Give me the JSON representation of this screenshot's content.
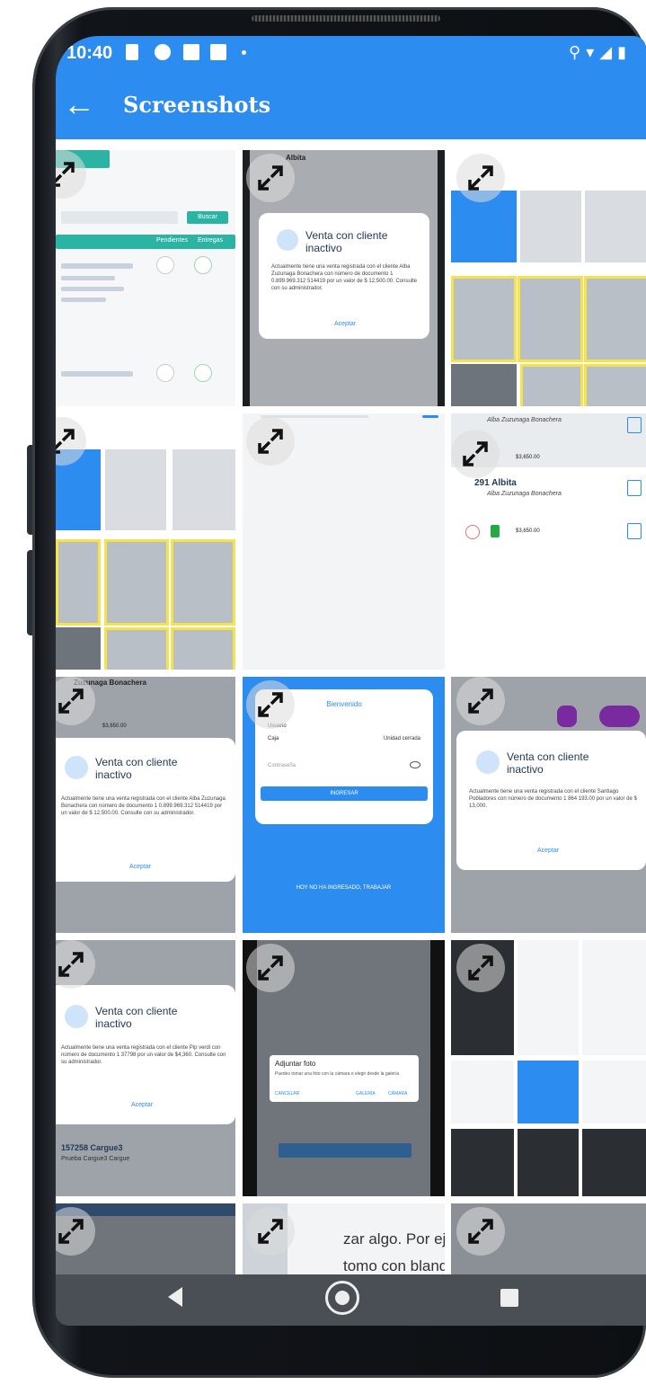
{
  "status_bar": {
    "time": "10:40"
  },
  "app_bar": {
    "title": "Screenshots",
    "back_icon": "arrow-left-icon"
  },
  "colors": {
    "accent": "#2d8cf0",
    "highlight": "#f4e34a",
    "overflow_dots": "#7a2a9f"
  },
  "tiles": {
    "t1": {
      "search_button": "Buscar",
      "tab_a": "Pendientes",
      "tab_b": "Entregas"
    },
    "t2": {
      "header": "Albita",
      "card_title": "Venta con cliente inactivo",
      "card_body": "Actualmente tiene una venta registrada con el cliente Alba Zuzunaga Bonachera con número de documento 1 0.899.969.312 514419 por un valor de $ 12,500.00. Consulte con su administrador.",
      "card_link": "Aceptar"
    },
    "t6": {
      "line1": "Alba Zuzunaga Bonachera",
      "name2": "291 Albita",
      "line2": "Alba Zuzunaga Bonachera",
      "amount1": "$3,650.00",
      "amount2": "$3,650.00"
    },
    "t7": {
      "header": "Zuzunaga Bonachera",
      "card_title": "Venta con cliente inactivo",
      "card_body": "Actualmente tiene una venta registrada con el cliente Alba Zuzunaga Bonachera con número de documento 1 0.899.969.312 514419 por un valor de $ 12,500.00. Consulte con su administrador.",
      "card_link": "Aceptar",
      "amount": "$3,650.00"
    },
    "t8": {
      "card_title": "Bienvenido",
      "field1": "Usuario",
      "field2": "Caja",
      "value2": "Unidad cerrada",
      "password_placeholder": "Contraseña",
      "button": "INGRESAR",
      "footer": "HOY NO HA INGRESADO, TRABAJAR"
    },
    "t9": {
      "card_title": "Venta con cliente inactivo",
      "card_body": "Actualmente tiene una venta registrada con el cliente Santiago Pobladores con número de documento 1 864 193.00 por un valor de $ 13,000.",
      "card_link": "Aceptar"
    },
    "t10": {
      "card_title": "Venta con cliente inactivo",
      "card_body": "Actualmente tiene una venta registrada con el cliente Pip verdi con número de documento 1 37798 por un valor de $4,360. Consulte con su administrador.",
      "card_link": "Aceptar",
      "bottom_title": "157258 Cargue3",
      "bottom_sub": "Prueba Cargue3 Cargue"
    },
    "t11": {
      "dialog_title": "Adjuntar foto",
      "dialog_body": "Puedes tomar una foto con la cámara o elegir desde la galería",
      "opt1": "CANCELAR",
      "opt2": "GALERÍA",
      "opt3": "CÁMARA"
    },
    "t14": {
      "text1": "zar algo. Por ejen",
      "text2": "tomo con blanqu"
    }
  },
  "nav": {
    "back_icon": "nav-back-icon",
    "home_icon": "nav-home-icon",
    "recent_icon": "nav-recent-icon"
  }
}
